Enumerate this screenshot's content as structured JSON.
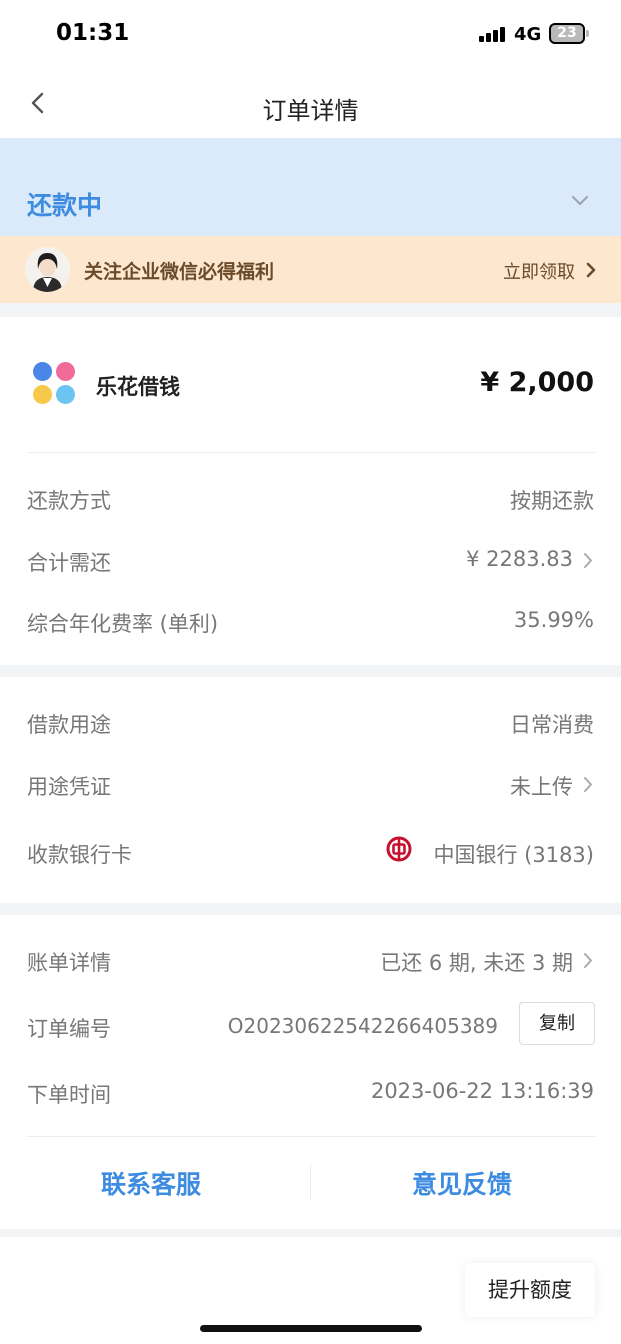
{
  "status_bar": {
    "time": "01:31",
    "network": "4G",
    "battery": "23"
  },
  "nav": {
    "title": "订单详情"
  },
  "status": {
    "label": "还款中"
  },
  "promo": {
    "text": "关注企业微信必得福利",
    "link": "立即领取"
  },
  "loan": {
    "lender": "乐花借钱",
    "amount": "¥ 2,000",
    "rows": [
      {
        "label": "还款方式",
        "value": "按期还款"
      },
      {
        "label": "合计需还",
        "value": "¥ 2283.83"
      },
      {
        "label": "综合年化费率 (单利)",
        "value": "35.99%"
      }
    ]
  },
  "usage": {
    "rows": [
      {
        "label": "借款用途",
        "value": "日常消费"
      },
      {
        "label": "用途凭证",
        "value": "未上传"
      },
      {
        "label": "收款银行卡",
        "value": "中国银行 (3183)"
      }
    ]
  },
  "order": {
    "rows": [
      {
        "label": "账单详情",
        "value": "已还 6 期, 未还 3 期"
      },
      {
        "label": "订单编号",
        "value": "O20230622542266405389"
      },
      {
        "label": "下单时间",
        "value": "2023-06-22 13:16:39"
      }
    ],
    "copy_label": "复制",
    "actions": {
      "contact": "联系客服",
      "feedback": "意见反馈"
    }
  },
  "float_button": {
    "label": "提升额度"
  },
  "colors": {
    "accent": "#3d8ce0",
    "status_band": "#dbeafa",
    "promo_bg": "#fde8cf",
    "promo_text": "#6b4b2a"
  }
}
